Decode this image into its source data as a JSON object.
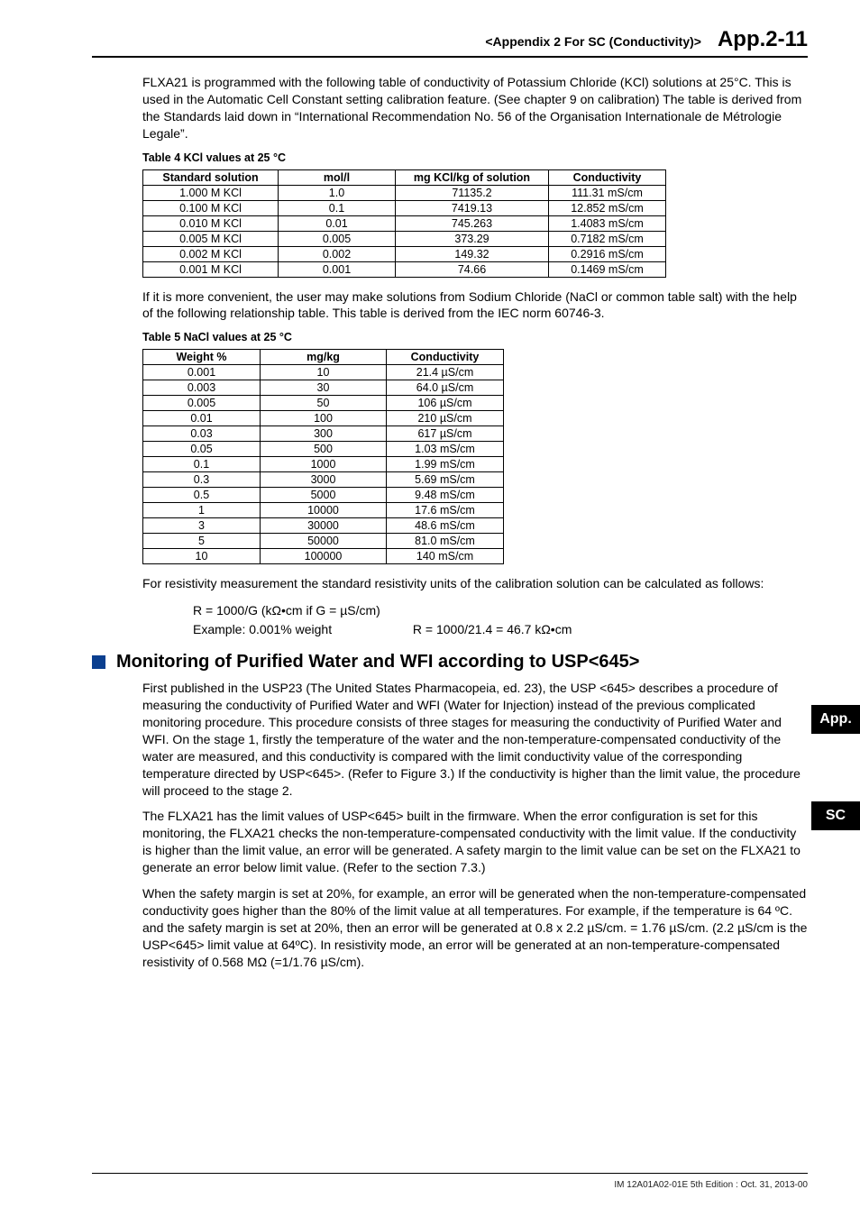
{
  "header": {
    "section": "<Appendix 2  For SC (Conductivity)>",
    "page": "App.2-11"
  },
  "intro1": "FLXA21 is programmed with the following table of conductivity of Potassium Chloride (KCl) solutions at 25°C. This is used in the Automatic Cell Constant setting calibration feature. (See chapter 9 on calibration) The table is derived from the Standards laid down in “International Recommendation No. 56 of the Organisation Internationale de Métrologie Legale”.",
  "table4": {
    "caption": "Table 4   KCl values at 25 °C",
    "headers": [
      "Standard solution",
      "mol/l",
      "mg KCl/kg of solution",
      "Conductivity"
    ],
    "rows": [
      [
        "1.000 M KCl",
        "1.0",
        "71135.2",
        "111.31 mS/cm"
      ],
      [
        "0.100 M KCl",
        "0.1",
        "7419.13",
        "12.852 mS/cm"
      ],
      [
        "0.010 M KCl",
        "0.01",
        "745.263",
        "1.4083 mS/cm"
      ],
      [
        "0.005 M KCl",
        "0.005",
        "373.29",
        "0.7182 mS/cm"
      ],
      [
        "0.002 M KCl",
        "0.002",
        "149.32",
        "0.2916 mS/cm"
      ],
      [
        "0.001 M KCl",
        "0.001",
        "74.66",
        "0.1469 mS/cm"
      ]
    ]
  },
  "intro2": "If it is more convenient, the user may make solutions from Sodium Chloride (NaCl or common table salt) with the help of the following relationship table. This table is derived from the IEC norm 60746-3.",
  "table5": {
    "caption": "Table 5   NaCl values at 25 °C",
    "headers": [
      "Weight %",
      "mg/kg",
      "Conductivity"
    ],
    "rows": [
      [
        "0.001",
        "10",
        "21.4 µS/cm"
      ],
      [
        "0.003",
        "30",
        "64.0 µS/cm"
      ],
      [
        "0.005",
        "50",
        "106 µS/cm"
      ],
      [
        "0.01",
        "100",
        "210 µS/cm"
      ],
      [
        "0.03",
        "300",
        "617 µS/cm"
      ],
      [
        "0.05",
        "500",
        "1.03 mS/cm"
      ],
      [
        "0.1",
        "1000",
        "1.99 mS/cm"
      ],
      [
        "0.3",
        "3000",
        "5.69 mS/cm"
      ],
      [
        "0.5",
        "5000",
        "9.48 mS/cm"
      ],
      [
        "1",
        "10000",
        "17.6 mS/cm"
      ],
      [
        "3",
        "30000",
        "48.6 mS/cm"
      ],
      [
        "5",
        "50000",
        "81.0 mS/cm"
      ],
      [
        "10",
        "100000",
        "140 mS/cm"
      ]
    ]
  },
  "resistivity_note": "For resistivity measurement the standard resistivity units of the calibration solution can be calculated as follows:",
  "formula1": "R = 1000/G (kΩ•cm if G = µS/cm)",
  "formula2a": "Example: 0.001% weight",
  "formula2b": "R = 1000/21.4 = 46.7 kΩ•cm",
  "section_heading": "Monitoring of Purified Water and WFI according to USP<645>",
  "p1": "First published in the USP23 (The United States Pharmacopeia, ed. 23), the USP <645> describes a procedure of measuring the conductivity of Purified Water and WFI (Water for Injection) instead of the previous complicated monitoring procedure. This procedure consists of three stages for measuring the conductivity of Purified Water and WFI. On the stage 1, firstly the temperature of the water and the non-temperature-compensated conductivity of the water are measured, and this conductivity is compared with the limit conductivity value of the corresponding temperature directed by USP<645>. (Refer to Figure 3.) If the conductivity is higher than the limit value, the procedure will proceed to the stage 2.",
  "p2": "The FLXA21 has the limit values of USP<645> built in the firmware. When the error configuration is set for this monitoring, the FLXA21 checks the non-temperature-compensated conductivity with the limit value. If the conductivity is higher than the limit value, an error will be generated. A safety margin to the limit value can be set on the FLXA21 to generate an error below limit value. (Refer to the section 7.3.)",
  "p3": "When the safety margin is set at 20%, for example, an error will be generated when the non-temperature-compensated conductivity goes higher than the 80% of the limit value at all temperatures. For example, if the temperature is 64 ºC. and the safety margin is set at 20%, then an error will be generated at 0.8 x 2.2 µS/cm. = 1.76 µS/cm. (2.2 µS/cm is the USP<645> limit value at 64ºC). In resistivity mode, an error will be generated at an non-temperature-compensated resistivity of 0.568 MΩ (=1/1.76 µS/cm).",
  "tabs": {
    "app": "App.",
    "sc": "SC"
  },
  "footer": "IM 12A01A02-01E     5th Edition : Oct. 31, 2013-00"
}
